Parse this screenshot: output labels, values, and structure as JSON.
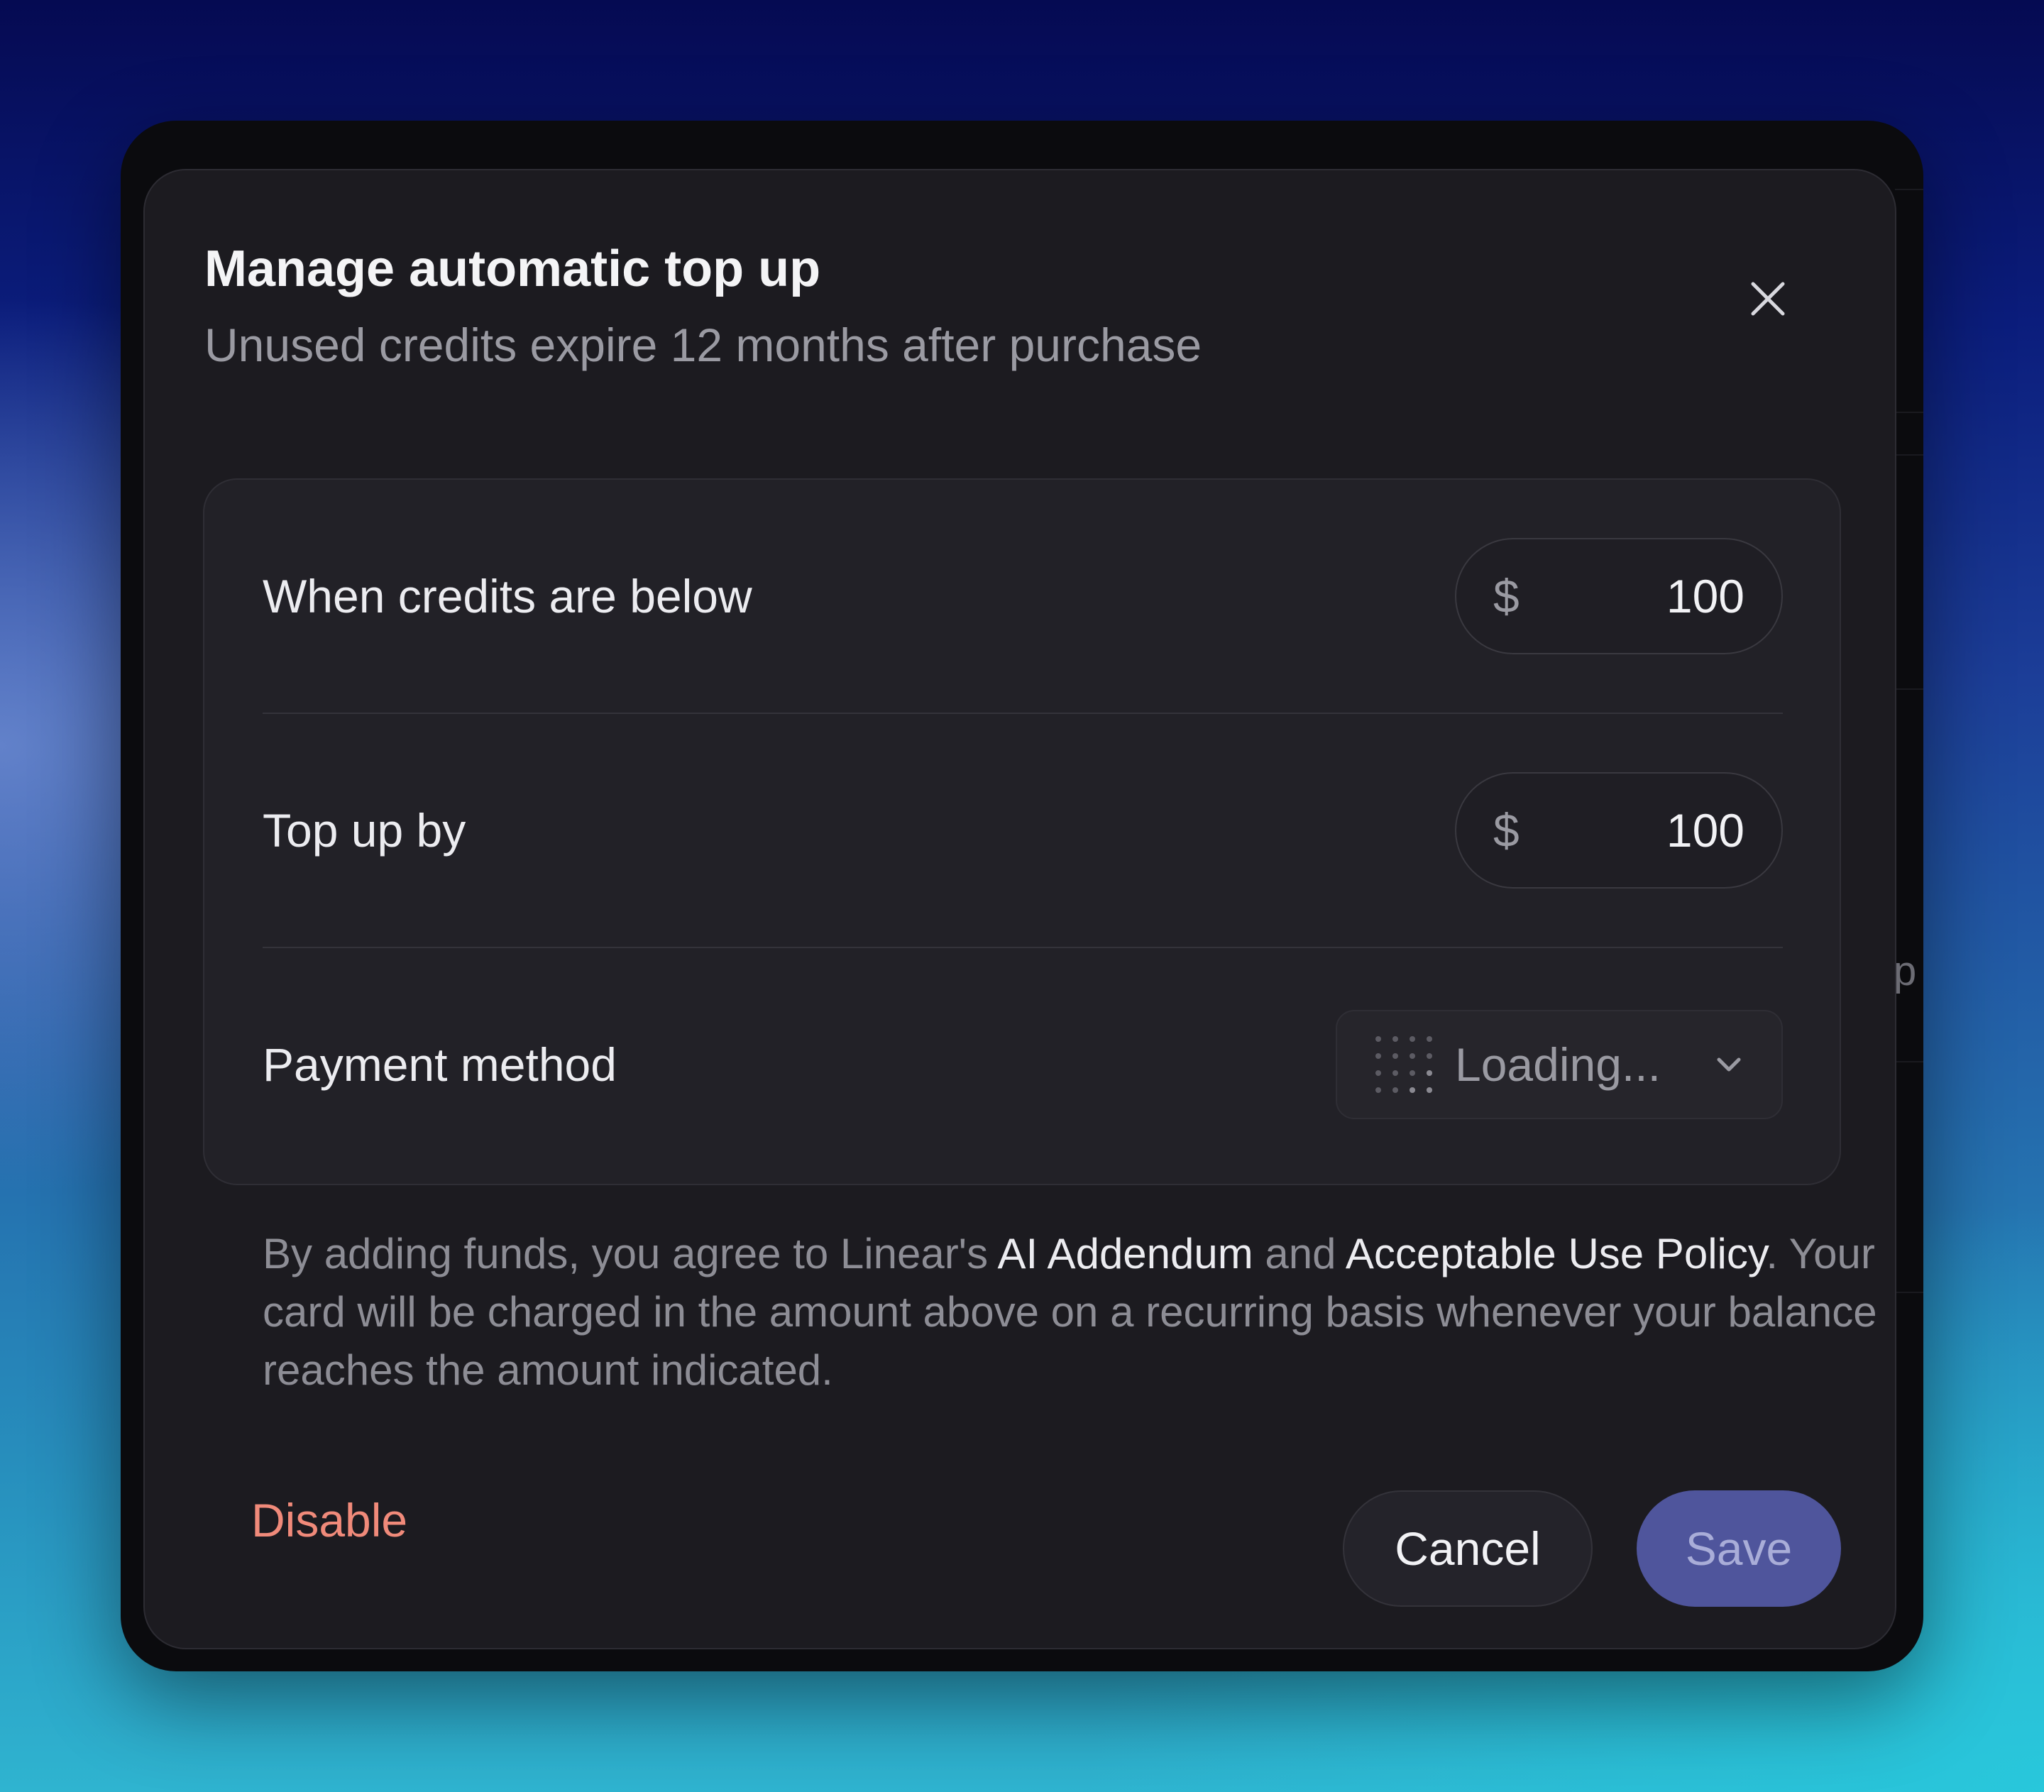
{
  "dialog": {
    "title": "Manage automatic top up",
    "subtitle": "Unused credits expire 12 months after purchase",
    "close_icon": "close-icon"
  },
  "settings": {
    "threshold": {
      "label": "When credits are below",
      "currency": "$",
      "value": "100"
    },
    "topup": {
      "label": "Top up by",
      "currency": "$",
      "value": "100"
    },
    "payment": {
      "label": "Payment method",
      "value": "Loading...",
      "loader_icon": "loading-dots-icon",
      "chevron_icon": "chevron-down-icon"
    }
  },
  "legal": {
    "prefix": "By adding funds, you agree to Linear's ",
    "link1": "AI Addendum",
    "middle": " and ",
    "link2": "Acceptable Use Policy",
    "suffix": ". Your card will be charged in the amount above on a recurring basis whenever your balance reaches the amount indicated."
  },
  "footer": {
    "disable_label": "Disable",
    "cancel_label": "Cancel",
    "save_label": "Save"
  },
  "background": {
    "peek_text": "p"
  },
  "colors": {
    "dialog_bg": "#1c1b20",
    "card_bg": "#222127",
    "danger": "#f08a7a",
    "primary": "#4f559c"
  }
}
